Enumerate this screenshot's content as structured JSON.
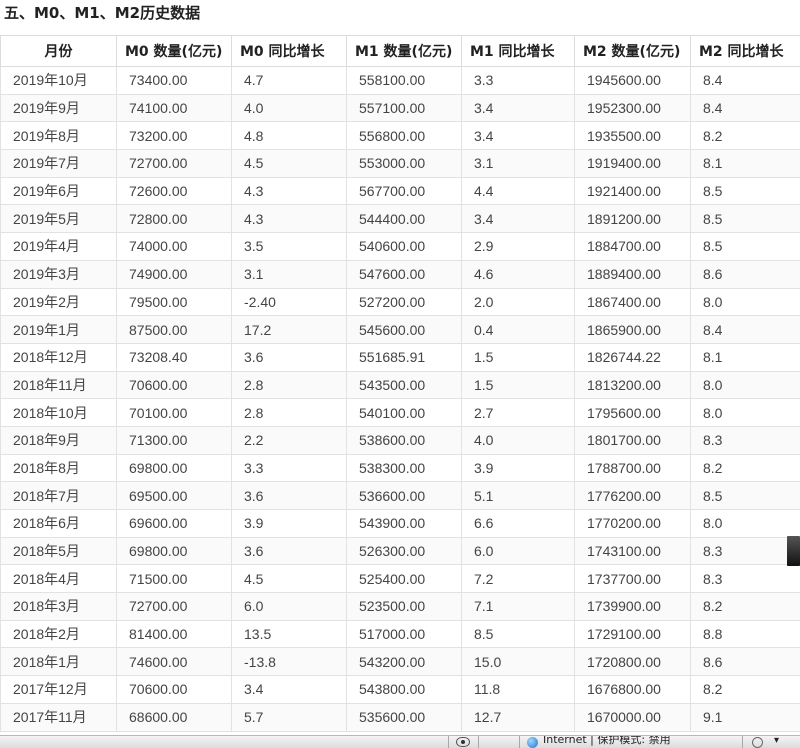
{
  "page": {
    "heading": "五、M0、M1、M2历史数据"
  },
  "table": {
    "columns": [
      "月份",
      "M0 数量(亿元)",
      "M0 同比增长",
      "M1 数量(亿元)",
      "M1 同比增长",
      "M2 数量(亿元)",
      "M2 同比增长"
    ],
    "rows": [
      [
        "2019年10月",
        "73400.00",
        "4.7",
        "558100.00",
        "3.3",
        "1945600.00",
        "8.4"
      ],
      [
        "2019年9月",
        "74100.00",
        "4.0",
        "557100.00",
        "3.4",
        "1952300.00",
        "8.4"
      ],
      [
        "2019年8月",
        "73200.00",
        "4.8",
        "556800.00",
        "3.4",
        "1935500.00",
        "8.2"
      ],
      [
        "2019年7月",
        "72700.00",
        "4.5",
        "553000.00",
        "3.1",
        "1919400.00",
        "8.1"
      ],
      [
        "2019年6月",
        "72600.00",
        "4.3",
        "567700.00",
        "4.4",
        "1921400.00",
        "8.5"
      ],
      [
        "2019年5月",
        "72800.00",
        "4.3",
        "544400.00",
        "3.4",
        "1891200.00",
        "8.5"
      ],
      [
        "2019年4月",
        "74000.00",
        "3.5",
        "540600.00",
        "2.9",
        "1884700.00",
        "8.5"
      ],
      [
        "2019年3月",
        "74900.00",
        "3.1",
        "547600.00",
        "4.6",
        "1889400.00",
        "8.6"
      ],
      [
        "2019年2月",
        "79500.00",
        "-2.40",
        "527200.00",
        "2.0",
        "1867400.00",
        "8.0"
      ],
      [
        "2019年1月",
        "87500.00",
        "17.2",
        "545600.00",
        "0.4",
        "1865900.00",
        "8.4"
      ],
      [
        "2018年12月",
        "73208.40",
        "3.6",
        "551685.91",
        "1.5",
        "1826744.22",
        "8.1"
      ],
      [
        "2018年11月",
        "70600.00",
        "2.8",
        "543500.00",
        "1.5",
        "1813200.00",
        "8.0"
      ],
      [
        "2018年10月",
        "70100.00",
        "2.8",
        "540100.00",
        "2.7",
        "1795600.00",
        "8.0"
      ],
      [
        "2018年9月",
        "71300.00",
        "2.2",
        "538600.00",
        "4.0",
        "1801700.00",
        "8.3"
      ],
      [
        "2018年8月",
        "69800.00",
        "3.3",
        "538300.00",
        "3.9",
        "1788700.00",
        "8.2"
      ],
      [
        "2018年7月",
        "69500.00",
        "3.6",
        "536600.00",
        "5.1",
        "1776200.00",
        "8.5"
      ],
      [
        "2018年6月",
        "69600.00",
        "3.9",
        "543900.00",
        "6.6",
        "1770200.00",
        "8.0"
      ],
      [
        "2018年5月",
        "69800.00",
        "3.6",
        "526300.00",
        "6.0",
        "1743100.00",
        "8.3"
      ],
      [
        "2018年4月",
        "71500.00",
        "4.5",
        "525400.00",
        "7.2",
        "1737700.00",
        "8.3"
      ],
      [
        "2018年3月",
        "72700.00",
        "6.0",
        "523500.00",
        "7.1",
        "1739900.00",
        "8.2"
      ],
      [
        "2018年2月",
        "81400.00",
        "13.5",
        "517000.00",
        "8.5",
        "1729100.00",
        "8.8"
      ],
      [
        "2018年1月",
        "74600.00",
        "-13.8",
        "543200.00",
        "15.0",
        "1720800.00",
        "8.6"
      ],
      [
        "2017年12月",
        "70600.00",
        "3.4",
        "543800.00",
        "11.8",
        "1676800.00",
        "8.2"
      ],
      [
        "2017年11月",
        "68600.00",
        "5.7",
        "535600.00",
        "12.7",
        "1670000.00",
        "9.1"
      ]
    ]
  },
  "status_bar": {
    "zone_text": "Internet | 保护模式: 禁用",
    "icons": [
      "eye-icon",
      "globe-icon",
      "zoom-icon",
      "dropdown-icon"
    ]
  }
}
